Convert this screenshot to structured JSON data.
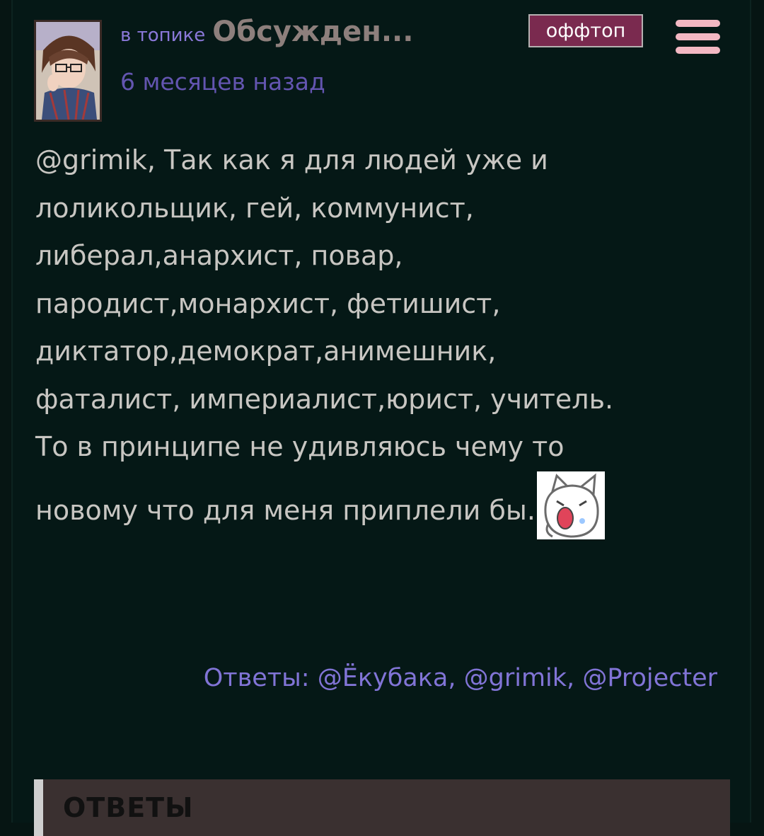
{
  "post": {
    "topic_prefix": "в топике",
    "topic_title": "Обсужден...",
    "timestamp": "6 месяцев назад",
    "tag": "оффтоп",
    "body_lines": [
      ", Так как я для людей уже и",
      "лоликольщик, гей, коммунист,",
      "либерал,анархист, повар,",
      "пародист,монархист, фетишист,",
      "диктатор,демократ,анимешник,",
      "фаталист, империалист,юрист, учитель.",
      "То в принципе не удивляюсь чему то",
      "новому что для меня приплели бы."
    ],
    "body_mention": "@grimik"
  },
  "replies": {
    "label": "Ответы:",
    "users": [
      "@Ёкубака",
      "@grimik",
      "@Projecter"
    ],
    "separator": ","
  },
  "answers_section": {
    "title": "ОТВЕТЫ"
  },
  "icons": {
    "menu": "hamburger-menu-icon",
    "avatar": "user-avatar",
    "sticker": "crying-cat-sticker"
  },
  "colors": {
    "background": "#051816",
    "body_text": "#c8c6c2",
    "accent_link": "#8174d6",
    "tag_bg": "#7a2a4f",
    "menu_icon": "#f3b8c3"
  }
}
